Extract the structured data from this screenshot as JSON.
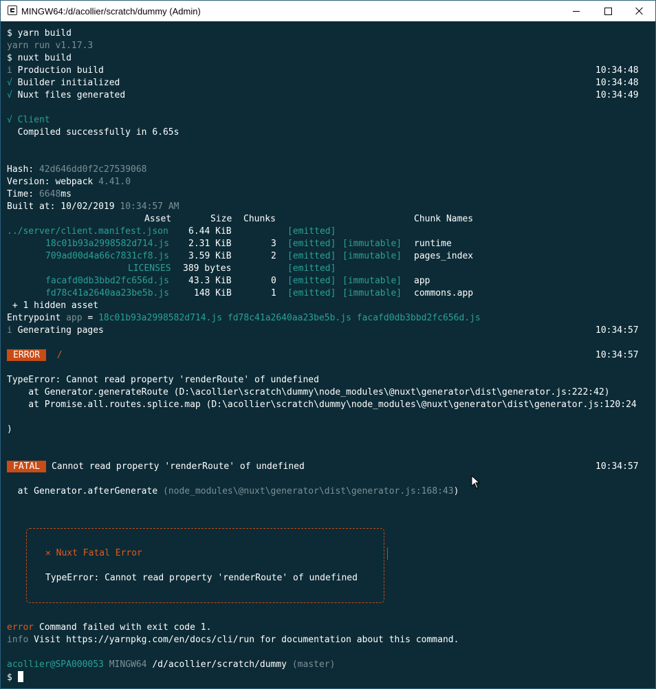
{
  "window": {
    "title": "MINGW64:/d/acollier/scratch/dummy (Admin)",
    "app_icon": "terminal-icon",
    "controls": {
      "minimize": "minimize-icon",
      "maximize": "maximize-icon",
      "close": "close-icon"
    }
  },
  "terminal": {
    "cmd_yarn_build": "$ yarn build",
    "yarn_version": "yarn run v1.17.3",
    "cmd_nuxt_build": "$ nuxt build",
    "production_build": {
      "marker": "i",
      "text": "Production build",
      "time": "10:34:48"
    },
    "builder_initialized": {
      "marker": "√",
      "text": "Builder initialized",
      "time": "10:34:48"
    },
    "nuxt_files_generated": {
      "marker": "√",
      "text": "Nuxt files generated",
      "time": "10:34:49"
    },
    "client": {
      "marker": "√",
      "text": "Client"
    },
    "compiled": "  Compiled successfully in 6.65s",
    "hash": {
      "label": "Hash: ",
      "value": "42d646dd0f2c27539068"
    },
    "version": {
      "label": "Version: ",
      "tool": "webpack",
      "value": " 4.41.0"
    },
    "time": {
      "label": "Time: ",
      "value": "6648",
      "unit": "ms"
    },
    "built_at": {
      "label": "Built at: ",
      "date": "10/02/2019",
      "time": " 10:34:57 AM"
    },
    "asset_table": {
      "headers": {
        "asset": "Asset",
        "size": "Size",
        "chunks": "Chunks",
        "chunk_names": "Chunk Names"
      },
      "rows": [
        {
          "asset": "../server/client.manifest.json",
          "size": "6.44 KiB",
          "chunks": "",
          "emitted": "[emitted]",
          "immutable": "",
          "name": ""
        },
        {
          "asset": "18c01b93a2998582d714.js",
          "size": "2.31 KiB",
          "chunks": "3",
          "emitted": "[emitted]",
          "immutable": "[immutable]",
          "name": "runtime"
        },
        {
          "asset": "709ad00d4a66c7831cf8.js",
          "size": "3.59 KiB",
          "chunks": "2",
          "emitted": "[emitted]",
          "immutable": "[immutable]",
          "name": "pages_index"
        },
        {
          "asset": "LICENSES",
          "size": "389 bytes",
          "chunks": "",
          "emitted": "[emitted]",
          "immutable": "",
          "name": ""
        },
        {
          "asset": "facafd0db3bbd2fc656d.js",
          "size": "43.3 KiB",
          "chunks": "0",
          "emitted": "[emitted]",
          "immutable": "[immutable]",
          "name": "app"
        },
        {
          "asset": "fd78c41a2640aa23be5b.js",
          "size": "148 KiB",
          "chunks": "1",
          "emitted": "[emitted]",
          "immutable": "[immutable]",
          "name": "commons.app"
        }
      ]
    },
    "hidden_asset": " + 1 hidden asset",
    "entrypoint": {
      "label": "Entrypoint ",
      "name": "app",
      "eq": " = ",
      "files": "18c01b93a2998582d714.js fd78c41a2640aa23be5b.js facafd0db3bbd2fc656d.js"
    },
    "generating_pages": {
      "marker": "i",
      "text": "Generating pages",
      "time": "10:34:57"
    },
    "error_line": {
      "badge": "ERROR",
      "route": "/",
      "time": "10:34:57"
    },
    "typeerror": "TypeError: Cannot read property 'renderRoute' of undefined",
    "stack_1": "    at Generator.generateRoute (D:\\acollier\\scratch\\dummy\\node_modules\\@nuxt\\generator\\dist\\generator.js:222:42)",
    "stack_2": "    at Promise.all.routes.splice.map (D:\\acollier\\scratch\\dummy\\node_modules\\@nuxt\\generator\\dist\\generator.js:120:24",
    "close_paren": ")",
    "fatal_line": {
      "badge": "FATAL",
      "text": "Cannot read property 'renderRoute' of undefined",
      "time": "10:34:57"
    },
    "after_generate": {
      "prefix": "  at Generator.afterGenerate ",
      "open": "(",
      "path": "node_modules\\@nuxt\\generator\\dist\\generator.js:168:43",
      "close": ")"
    },
    "fatal_box": {
      "icon": "✕",
      "title": "Nuxt Fatal Error",
      "message": "TypeError: Cannot read property 'renderRoute' of undefined"
    },
    "yarn_error": {
      "label": "error",
      "text": " Command failed with exit code 1."
    },
    "yarn_info": {
      "label": "info",
      "text": " Visit https://yarnpkg.com/en/docs/cli/run for documentation about this command."
    },
    "prompt": {
      "user": "acollier@SPA000053",
      "system": "MINGW64",
      "path": "/d/acollier/scratch/dummy",
      "branch": "(master)",
      "symbol": "$ "
    }
  },
  "colors": {
    "background": "#0c2b36",
    "teal": "#2aa198",
    "gray": "#7d8f96",
    "badge": "#c94b16",
    "text": "#ffffff"
  }
}
